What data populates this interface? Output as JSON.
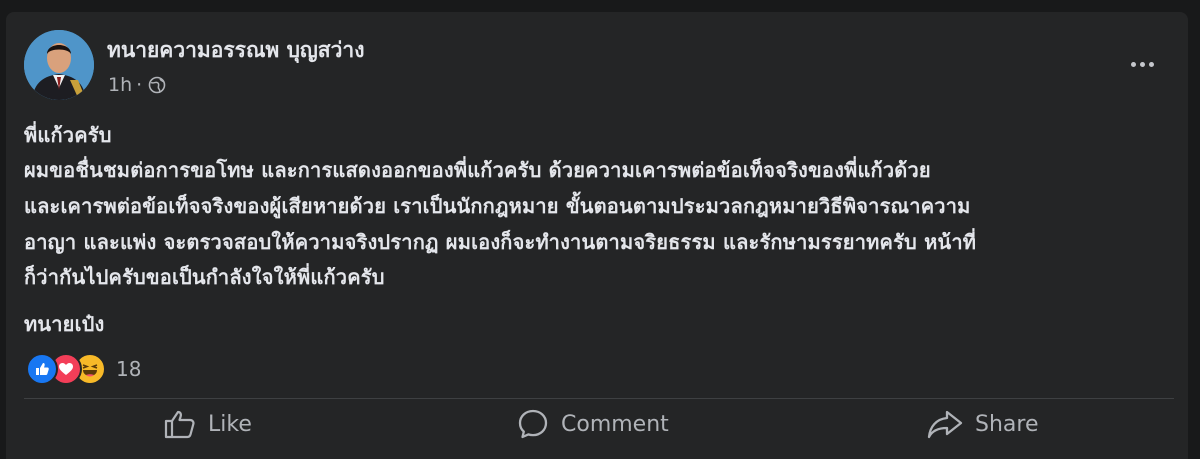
{
  "post": {
    "author": "ทนายความอรรณพ บุญสว่าง",
    "time": "1h",
    "audience_icon": "globe-icon",
    "more_icon": "more-options-icon",
    "body_lines": [
      "พี่แก้วครับ",
      "ผมขอชื่นชมต่อการขอโทษ และการแสดงออกของพี่แก้วครับ ด้วยความเคารพต่อข้อเท็จจริงของพี่แก้วด้วย",
      "และเคารพต่อข้อเท็จจริงของผู้เสียหายด้วย เราเป็นนักกฎหมาย ขั้นตอนตามประมวลกฎหมายวิธีพิจารณาความ",
      "อาญา และแพ่ง จะตรวจสอบให้ความจริงปรากฏ ผมเองก็จะทำงานตามจริยธรรม และรักษามรรยาทครับ หน้าที่",
      "ก็ว่ากันไปครับขอเป็นกำลังใจให้พี่แก้วครับ"
    ],
    "signature": "ทนายเป๋ง",
    "reactions": {
      "icons": [
        "like-reaction-icon",
        "love-reaction-icon",
        "haha-reaction-icon"
      ],
      "count": "18"
    },
    "actions": {
      "like": "Like",
      "comment": "Comment",
      "share": "Share"
    }
  },
  "colors": {
    "background": "#18191a",
    "card": "#242526",
    "text_primary": "#e4e6eb",
    "text_secondary": "#b0b3b8",
    "like_blue": "#1877f2",
    "love_red": "#f33e58",
    "haha_yellow": "#f7b928"
  }
}
